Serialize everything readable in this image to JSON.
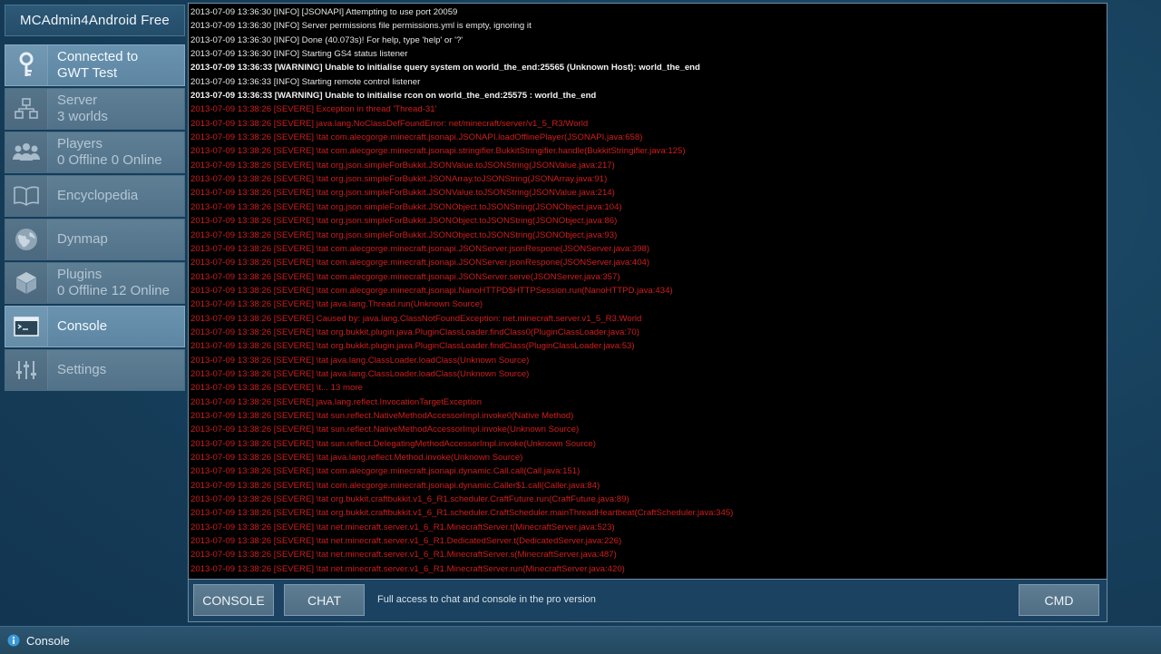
{
  "app": {
    "title": "MCAdmin4Android Free"
  },
  "sidebar": {
    "items": [
      {
        "line1": "Connected to",
        "line2": "GWT Test",
        "icon": "key-icon",
        "selected": true
      },
      {
        "line1": "Server",
        "line2": "3 worlds",
        "icon": "server-network-icon"
      },
      {
        "line1": "Players",
        "line2": "0 Offline 0 Online",
        "icon": "players-group-icon"
      },
      {
        "line1": "Encyclopedia",
        "line2": "",
        "icon": "book-icon"
      },
      {
        "line1": "Dynmap",
        "line2": "",
        "icon": "globe-icon"
      },
      {
        "line1": "Plugins",
        "line2": "0 Offline 12 Online",
        "icon": "cube-icon"
      },
      {
        "line1": "Console",
        "line2": "",
        "icon": "console-icon",
        "selected": true
      },
      {
        "line1": "Settings",
        "line2": "",
        "icon": "sliders-icon"
      }
    ]
  },
  "console": {
    "lines": [
      {
        "level": "info",
        "text": "2013-07-09 13:36:30 [INFO] [JSONAPI] Attempting to use port 20059"
      },
      {
        "level": "info",
        "text": "2013-07-09 13:36:30 [INFO] Server permissions file permissions.yml is empty, ignoring it"
      },
      {
        "level": "info",
        "text": "2013-07-09 13:36:30 [INFO] Done (40.073s)! For help, type 'help' or '?'"
      },
      {
        "level": "info",
        "text": "2013-07-09 13:36:30 [INFO] Starting GS4 status listener"
      },
      {
        "level": "warning",
        "text": "2013-07-09 13:36:33 [WARNING] Unable to initialise query system on world_the_end:25565 (Unknown Host): world_the_end"
      },
      {
        "level": "info",
        "text": "2013-07-09 13:36:33 [INFO] Starting remote control listener"
      },
      {
        "level": "warning",
        "text": "2013-07-09 13:36:33 [WARNING] Unable to initialise rcon on world_the_end:25575 : world_the_end"
      },
      {
        "level": "severe",
        "text": "2013-07-09 13:38:26 [SEVERE] Exception in thread 'Thread-31'"
      },
      {
        "level": "severe",
        "text": "2013-07-09 13:38:26 [SEVERE] java.lang.NoClassDefFoundError: net/minecraft/server/v1_5_R3/World"
      },
      {
        "level": "severe",
        "text": "2013-07-09 13:38:26 [SEVERE] \\tat com.alecgorge.minecraft.jsonapi.JSONAPI.loadOfflinePlayer(JSONAPI.java:658)"
      },
      {
        "level": "severe",
        "text": "2013-07-09 13:38:26 [SEVERE] \\tat com.alecgorge.minecraft.jsonapi.stringifier.BukkitStringifier.handle(BukkitStringifier.java:125)"
      },
      {
        "level": "severe",
        "text": "2013-07-09 13:38:26 [SEVERE] \\tat org.json.simpleForBukkit.JSONValue.toJSONString(JSONValue.java:217)"
      },
      {
        "level": "severe",
        "text": "2013-07-09 13:38:26 [SEVERE] \\tat org.json.simpleForBukkit.JSONArray.toJSONString(JSONArray.java:91)"
      },
      {
        "level": "severe",
        "text": "2013-07-09 13:38:26 [SEVERE] \\tat org.json.simpleForBukkit.JSONValue.toJSONString(JSONValue.java:214)"
      },
      {
        "level": "severe",
        "text": "2013-07-09 13:38:26 [SEVERE] \\tat org.json.simpleForBukkit.JSONObject.toJSONString(JSONObject.java:104)"
      },
      {
        "level": "severe",
        "text": "2013-07-09 13:38:26 [SEVERE] \\tat org.json.simpleForBukkit.JSONObject.toJSONString(JSONObject.java:86)"
      },
      {
        "level": "severe",
        "text": "2013-07-09 13:38:26 [SEVERE] \\tat org.json.simpleForBukkit.JSONObject.toJSONString(JSONObject.java:93)"
      },
      {
        "level": "severe",
        "text": "2013-07-09 13:38:26 [SEVERE] \\tat com.alecgorge.minecraft.jsonapi.JSONServer.jsonRespone(JSONServer.java:398)"
      },
      {
        "level": "severe",
        "text": "2013-07-09 13:38:26 [SEVERE] \\tat com.alecgorge.minecraft.jsonapi.JSONServer.jsonRespone(JSONServer.java:404)"
      },
      {
        "level": "severe",
        "text": "2013-07-09 13:38:26 [SEVERE] \\tat com.alecgorge.minecraft.jsonapi.JSONServer.serve(JSONServer.java:357)"
      },
      {
        "level": "severe",
        "text": "2013-07-09 13:38:26 [SEVERE] \\tat com.alecgorge.minecraft.jsonapi.NanoHTTPD$HTTPSession.run(NanoHTTPD.java:434)"
      },
      {
        "level": "severe",
        "text": "2013-07-09 13:38:26 [SEVERE] \\tat java.lang.Thread.run(Unknown Source)"
      },
      {
        "level": "severe",
        "text": "2013-07-09 13:38:26 [SEVERE] Caused by: java.lang.ClassNotFoundException: net.minecraft.server.v1_5_R3.World"
      },
      {
        "level": "severe",
        "text": "2013-07-09 13:38:26 [SEVERE] \\tat org.bukkit.plugin.java.PluginClassLoader.findClass0(PluginClassLoader.java:70)"
      },
      {
        "level": "severe",
        "text": "2013-07-09 13:38:26 [SEVERE] \\tat org.bukkit.plugin.java.PluginClassLoader.findClass(PluginClassLoader.java:53)"
      },
      {
        "level": "severe",
        "text": "2013-07-09 13:38:26 [SEVERE] \\tat java.lang.ClassLoader.loadClass(Unknown Source)"
      },
      {
        "level": "severe",
        "text": "2013-07-09 13:38:26 [SEVERE] \\tat java.lang.ClassLoader.loadClass(Unknown Source)"
      },
      {
        "level": "severe",
        "text": "2013-07-09 13:38:26 [SEVERE] \\t... 13 more"
      },
      {
        "level": "severe",
        "text": "2013-07-09 13:38:26 [SEVERE] java.lang.reflect.InvocationTargetException"
      },
      {
        "level": "severe",
        "text": "2013-07-09 13:38:26 [SEVERE] \\tat sun.reflect.NativeMethodAccessorImpl.invoke0(Native Method)"
      },
      {
        "level": "severe",
        "text": "2013-07-09 13:38:26 [SEVERE] \\tat sun.reflect.NativeMethodAccessorImpl.invoke(Unknown Source)"
      },
      {
        "level": "severe",
        "text": "2013-07-09 13:38:26 [SEVERE] \\tat sun.reflect.DelegatingMethodAccessorImpl.invoke(Unknown Source)"
      },
      {
        "level": "severe",
        "text": "2013-07-09 13:38:26 [SEVERE] \\tat java.lang.reflect.Method.invoke(Unknown Source)"
      },
      {
        "level": "severe",
        "text": "2013-07-09 13:38:26 [SEVERE] \\tat com.alecgorge.minecraft.jsonapi.dynamic.Call.call(Call.java:151)"
      },
      {
        "level": "severe",
        "text": "2013-07-09 13:38:26 [SEVERE] \\tat com.alecgorge.minecraft.jsonapi.dynamic.Caller$1.call(Caller.java:84)"
      },
      {
        "level": "severe",
        "text": "2013-07-09 13:38:26 [SEVERE] \\tat org.bukkit.craftbukkit.v1_6_R1.scheduler.CraftFuture.run(CraftFuture.java:89)"
      },
      {
        "level": "severe",
        "text": "2013-07-09 13:38:26 [SEVERE] \\tat org.bukkit.craftbukkit.v1_6_R1.scheduler.CraftScheduler.mainThreadHeartbeat(CraftScheduler.java:345)"
      },
      {
        "level": "severe",
        "text": "2013-07-09 13:38:26 [SEVERE] \\tat net.minecraft.server.v1_6_R1.MinecraftServer.t(MinecraftServer.java:523)"
      },
      {
        "level": "severe",
        "text": "2013-07-09 13:38:26 [SEVERE] \\tat net.minecraft.server.v1_6_R1.DedicatedServer.t(DedicatedServer.java:226)"
      },
      {
        "level": "severe",
        "text": "2013-07-09 13:38:26 [SEVERE] \\tat net.minecraft.server.v1_6_R1.MinecraftServer.s(MinecraftServer.java:487)"
      },
      {
        "level": "severe",
        "text": "2013-07-09 13:38:26 [SEVERE] \\tat net.minecraft.server.v1_6_R1.MinecraftServer.run(MinecraftServer.java:420)"
      }
    ]
  },
  "bottom_bar": {
    "console_label": "CONSOLE",
    "chat_label": "CHAT",
    "pro_note": "Full access to chat and console in the pro version",
    "cmd_label": "CMD"
  },
  "status_bar": {
    "label": "Console",
    "icon": "info-icon"
  },
  "colors": {
    "severe": "#d01d1d",
    "info": "#e6e6e6",
    "accent": "#5d86a3"
  }
}
